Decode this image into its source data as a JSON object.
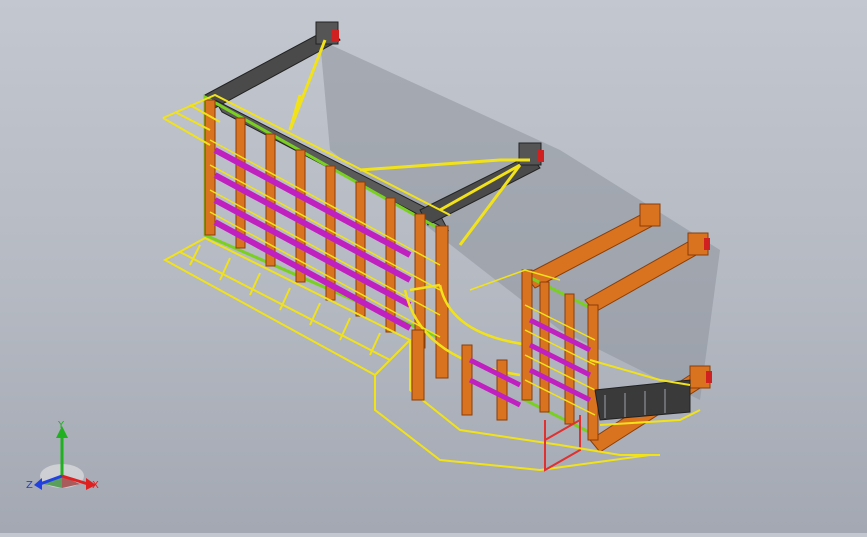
{
  "triad": {
    "x_label": "X",
    "y_label": "Y",
    "z_label": "Z",
    "x_color": "#e02020",
    "y_color": "#20b020",
    "z_color": "#2040e0"
  },
  "colors": {
    "background_top": "#c3c7cf",
    "background_bottom": "#a3a8b2",
    "beam_dark": "#4a4a4a",
    "beam_orange": "#d9731f",
    "cross_member": "#c020c0",
    "rail_yellow": "#f2e21a",
    "green_edge": "#7ad020",
    "end_plate": "#d02020"
  }
}
